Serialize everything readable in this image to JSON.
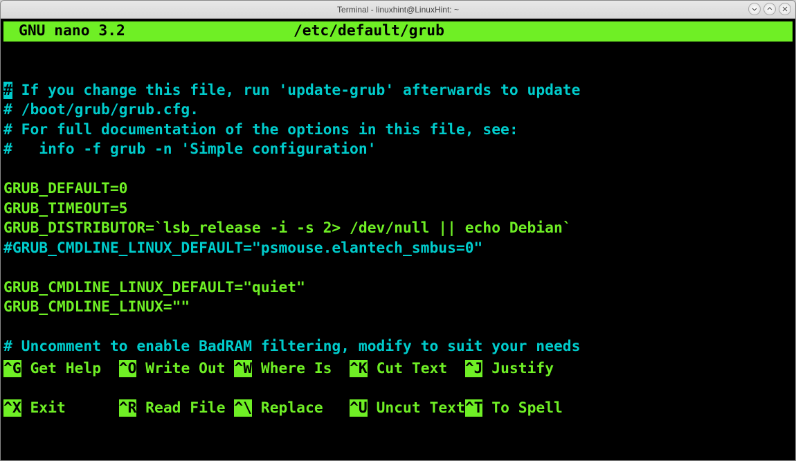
{
  "window": {
    "title": "Terminal - linuxhint@LinuxHint: ~"
  },
  "nano": {
    "version": "GNU nano 3.2",
    "filename": "/etc/default/grub"
  },
  "file": {
    "l1_cursor": "#",
    "l1_rest": " If you change this file, run 'update-grub' afterwards to update",
    "l2": "# /boot/grub/grub.cfg.",
    "l3": "# For full documentation of the options in this file, see:",
    "l4": "#   info -f grub -n 'Simple configuration'",
    "l5": "",
    "l6": "GRUB_DEFAULT=0",
    "l7": "GRUB_TIMEOUT=5",
    "l8": "GRUB_DISTRIBUTOR=`lsb_release -i -s 2> /dev/null || echo Debian`",
    "l9": "#GRUB_CMDLINE_LINUX_DEFAULT=\"psmouse.elantech_smbus=0\"",
    "l10": "",
    "l11": "GRUB_CMDLINE_LINUX_DEFAULT=\"quiet\"",
    "l12": "GRUB_CMDLINE_LINUX=\"\"",
    "l13": "",
    "l14": "# Uncomment to enable BadRAM filtering, modify to suit your needs"
  },
  "shortcuts": {
    "r1": {
      "k1": "^G",
      "t1": " Get Help  ",
      "k2": "^O",
      "t2": " Write Out ",
      "k3": "^W",
      "t3": " Where Is  ",
      "k4": "^K",
      "t4": " Cut Text  ",
      "k5": "^J",
      "t5": " Justify"
    },
    "r2": {
      "k1": "^X",
      "t1": " Exit      ",
      "k2": "^R",
      "t2": " Read File ",
      "k3": "^\\",
      "t3": " Replace   ",
      "k4": "^U",
      "t4": " Uncut Text",
      "k5": "^T",
      "t5": " To Spell"
    }
  }
}
